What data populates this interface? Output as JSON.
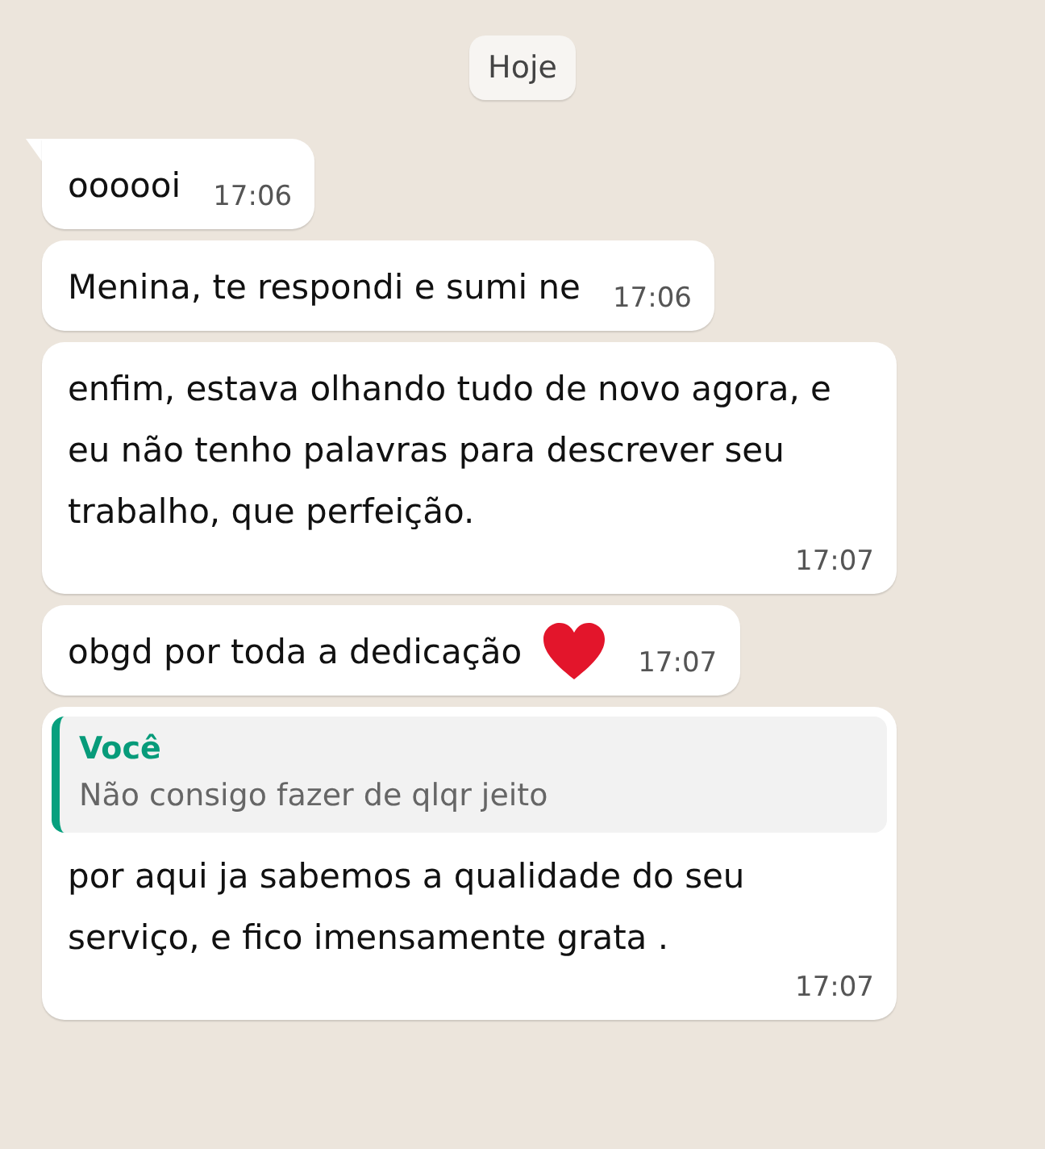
{
  "date_chip": "Hoje",
  "messages": [
    {
      "kind": "text",
      "text": "oooooi",
      "time": "17:06",
      "tail": true
    },
    {
      "kind": "text",
      "text": "Menina, te respondi e sumi ne",
      "time": "17:06",
      "tail": false
    },
    {
      "kind": "text",
      "text": "enfim, estava olhando tudo de novo agora, e eu não tenho palavras para descrever seu trabalho, que perfeição.",
      "time": "17:07",
      "tail": false
    },
    {
      "kind": "heart",
      "text": "obgd por toda a dedicação",
      "time": "17:07",
      "tail": false
    },
    {
      "kind": "reply",
      "quote": {
        "author": "Você",
        "text": "Não consigo fazer de qlqr jeito"
      },
      "text": "por aqui ja sabemos a qualidade do seu serviço, e fico imensamente grata .",
      "time": "17:07",
      "tail": false
    }
  ]
}
